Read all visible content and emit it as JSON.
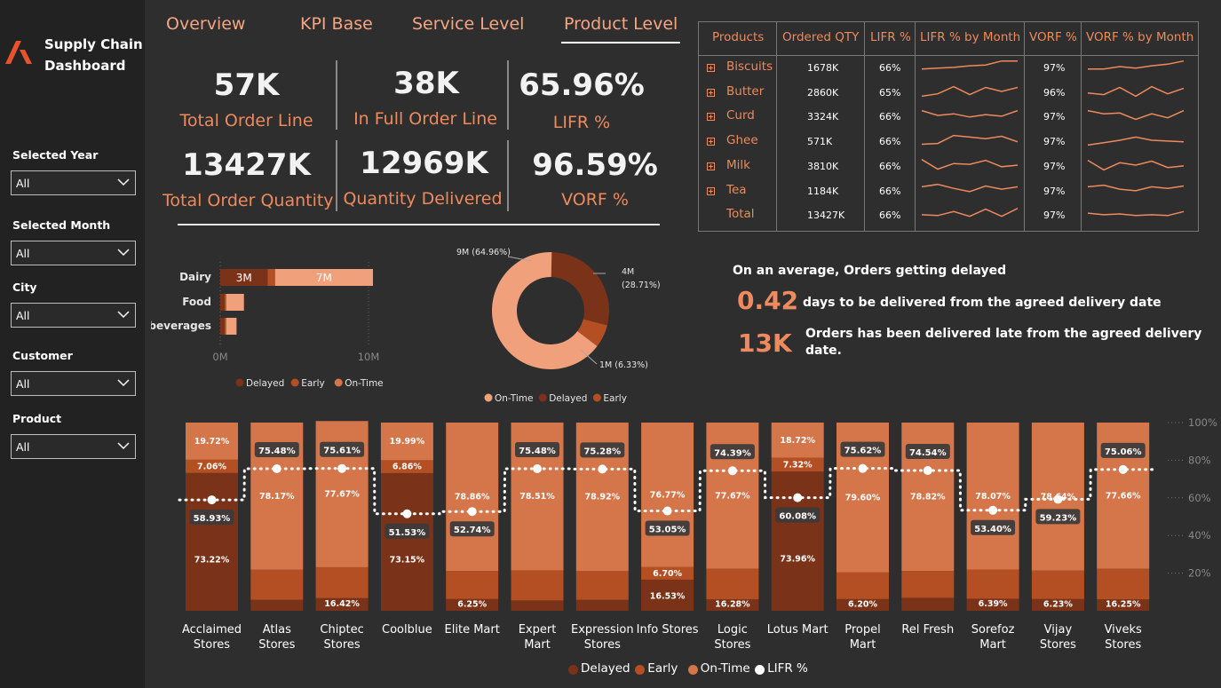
{
  "app": {
    "title_line1": "Supply Chain",
    "title_line2": "Dashboard"
  },
  "tabs": [
    {
      "label": "Overview"
    },
    {
      "label": "KPI Base"
    },
    {
      "label": "Service Level"
    },
    {
      "label": "Product Level"
    }
  ],
  "filters": [
    {
      "label": "Selected Year",
      "value": "All"
    },
    {
      "label": "Selected Month",
      "value": "All"
    },
    {
      "label": "City",
      "value": "All"
    },
    {
      "label": "Customer",
      "value": "All"
    },
    {
      "label": "Product",
      "value": "All"
    }
  ],
  "kpis": [
    {
      "value": "57K",
      "label": "Total Order Line"
    },
    {
      "value": "38K",
      "label": "In Full Order Line"
    },
    {
      "value": "65.96%",
      "label": "LIFR %"
    },
    {
      "value": "13427K",
      "label": "Total Order Quantity"
    },
    {
      "value": "12969K",
      "label": "Quantity Delivered"
    },
    {
      "value": "96.59%",
      "label": "VORF %"
    }
  ],
  "product_table": {
    "headers": [
      "Products",
      "Ordered QTY",
      "LIFR %",
      "LIFR % by Month",
      "VORF %",
      "VORF % by Month"
    ],
    "rows": [
      {
        "name": "Biscuits",
        "qty": "1678K",
        "lifr": "66%",
        "vorf": "97%",
        "lifr_trend": [
          0.35,
          0.4,
          0.45,
          0.55,
          0.6,
          0.85,
          0.85
        ],
        "vorf_trend": [
          0.35,
          0.35,
          0.5,
          0.4,
          0.55,
          0.65,
          0.85
        ]
      },
      {
        "name": "Butter",
        "qty": "2860K",
        "lifr": "65%",
        "vorf": "96%",
        "lifr_trend": [
          0.2,
          0.35,
          0.8,
          0.3,
          0.75,
          0.5,
          0.75
        ],
        "vorf_trend": [
          0.4,
          0.3,
          0.75,
          0.2,
          0.8,
          0.35,
          0.7
        ]
      },
      {
        "name": "Curd",
        "qty": "3324K",
        "lifr": "66%",
        "vorf": "97%",
        "lifr_trend": [
          0.8,
          0.5,
          0.6,
          0.4,
          0.55,
          0.45,
          0.8
        ],
        "vorf_trend": [
          0.8,
          0.6,
          0.65,
          0.25,
          0.6,
          0.35,
          0.8
        ]
      },
      {
        "name": "Ghee",
        "qty": "571K",
        "lifr": "66%",
        "vorf": "97%",
        "lifr_trend": [
          0.25,
          0.3,
          0.8,
          0.7,
          0.6,
          0.75,
          0.4
        ],
        "vorf_trend": [
          0.2,
          0.35,
          0.5,
          0.7,
          0.5,
          0.45,
          0.4
        ]
      },
      {
        "name": "Milk",
        "qty": "3810K",
        "lifr": "66%",
        "vorf": "97%",
        "lifr_trend": [
          0.85,
          0.25,
          0.6,
          0.55,
          0.8,
          0.4,
          0.5
        ],
        "vorf_trend": [
          0.8,
          0.2,
          0.65,
          0.5,
          0.75,
          0.35,
          0.45
        ]
      },
      {
        "name": "Tea",
        "qty": "1184K",
        "lifr": "66%",
        "vorf": "97%",
        "lifr_trend": [
          0.7,
          0.85,
          0.6,
          0.4,
          0.75,
          0.55,
          0.7
        ],
        "vorf_trend": [
          0.7,
          0.8,
          0.55,
          0.45,
          0.7,
          0.6,
          0.75
        ]
      },
      {
        "name": "Total",
        "qty": "13427K",
        "lifr": "66%",
        "vorf": "97%",
        "lifr_trend": [
          0.45,
          0.4,
          0.65,
          0.35,
          0.8,
          0.35,
          0.85
        ],
        "vorf_trend": [
          0.55,
          0.45,
          0.5,
          0.4,
          0.45,
          0.4,
          0.65
        ]
      }
    ]
  },
  "category_chart": {
    "categories": [
      "Dairy",
      "Food",
      "beverages"
    ],
    "axis_labels": [
      "0M",
      "10M"
    ],
    "legend": [
      "Delayed",
      "Early",
      "On-Time"
    ]
  },
  "donut_chart": {
    "labels": [
      "9M (64.96%)",
      "4M",
      "(28.71%)",
      "1M (6.33%)"
    ],
    "legend": [
      "On-Time",
      "Delayed",
      "Early"
    ]
  },
  "delay": {
    "heading": "On an average, Orders getting delayed",
    "days_value": "0.42",
    "days_desc": "days to be delivered from the agreed delivery date",
    "late_value": "13K",
    "late_desc_line1": "Orders has been delivered late from the agreed delivery",
    "late_desc_line2": "date."
  },
  "colors": {
    "delayed": "#7a3319",
    "early": "#b34f22",
    "ontime": "#d4754a",
    "ontime_light": "#f0a07a",
    "accent": "#ee8a5d",
    "lifr": "#ffffff"
  },
  "chart_data": [
    {
      "type": "bar",
      "title": "",
      "orientation": "horizontal",
      "stacked": true,
      "categories": [
        "Dairy",
        "Food",
        "beverages"
      ],
      "series": [
        {
          "name": "Delayed",
          "values": [
            3.2,
            0.3,
            0.3
          ]
        },
        {
          "name": "Early",
          "values": [
            0.5,
            0.1,
            0.1
          ]
        },
        {
          "name": "On-Time",
          "values": [
            6.6,
            1.2,
            0.7
          ]
        }
      ],
      "data_labels": [
        "3M",
        "7M"
      ],
      "xlim": [
        0,
        10
      ],
      "xunit": "M",
      "legend_position": "bottom"
    },
    {
      "type": "pie",
      "title": "",
      "donut": true,
      "labels": [
        "On-Time",
        "Delayed",
        "Early"
      ],
      "values": [
        64.96,
        28.71,
        6.33
      ],
      "legend_position": "bottom"
    },
    {
      "type": "bar",
      "title": "",
      "stacked": true,
      "percent": true,
      "categories": [
        "Acclaimed Stores",
        "Atlas Stores",
        "Chiptec Stores",
        "Coolblue",
        "Elite Mart",
        "Expert Mart",
        "Expression Stores",
        "Info Stores",
        "Logic Stores",
        "Lotus Mart",
        "Propel Mart",
        "Rel Fresh",
        "Sorefoz Mart",
        "Vijay Stores",
        "Viveks Stores"
      ],
      "series": [
        {
          "name": "Delayed",
          "values": [
            73.22,
            5.83,
            6.72,
            73.15,
            6.25,
            5.49,
            5.8,
            16.53,
            6.05,
            73.96,
            6.2,
            6.88,
            6.39,
            6.23,
            6.09
          ]
        },
        {
          "name": "Early",
          "values": [
            7.06,
            16.0,
            16.42,
            6.86,
            14.89,
            16.0,
            15.28,
            6.7,
            16.28,
            7.32,
            14.2,
            14.3,
            15.54,
            15.13,
            16.25
          ]
        },
        {
          "name": "On-Time",
          "values": [
            19.72,
            78.17,
            77.67,
            19.99,
            78.86,
            78.51,
            78.92,
            76.77,
            77.67,
            18.72,
            79.6,
            78.82,
            78.07,
            78.64,
            77.66
          ]
        }
      ],
      "bar_labels_top": [
        "19.72%",
        "",
        "",
        "19.99%",
        "",
        "",
        "",
        "",
        "",
        "18.72%",
        "",
        "",
        "",
        "",
        ""
      ],
      "bar_labels_mid": [
        "7.06%",
        "78.17%",
        "77.67%",
        "6.86%",
        "78.86%",
        "78.51%",
        "78.92%",
        "76.77%",
        "77.67%",
        "7.32%",
        "79.60%",
        "78.82%",
        "78.07%",
        "78.64%",
        "77.66%"
      ],
      "bar_labels_low": [
        "73.22%",
        "",
        "16.42%",
        "73.15%",
        "6.25%",
        "",
        "",
        "6.70%",
        "16.28%",
        "73.96%",
        "6.20%",
        "",
        "6.39%",
        "6.23%",
        "16.25%"
      ],
      "bar_labels_extra": [
        "",
        "",
        "",
        "",
        "",
        "",
        "",
        "16.53%",
        "",
        "",
        "",
        "",
        "",
        "",
        ""
      ],
      "line_series": {
        "name": "LIFR %",
        "values": [
          58.93,
          75.48,
          75.61,
          51.53,
          52.74,
          75.48,
          75.28,
          53.05,
          74.39,
          60.08,
          75.62,
          74.54,
          53.4,
          59.23,
          75.06
        ]
      },
      "line_labels": [
        "58.93%",
        "75.48%",
        "75.61%",
        "51.53%",
        "52.74%",
        "75.48%",
        "75.28%",
        "53.05%",
        "74.39%",
        "60.08%",
        "75.62%",
        "74.54%",
        "53.40%",
        "59.23%",
        "75.06%"
      ],
      "y_ticks": [
        "100%",
        "80%",
        "60%",
        "40%",
        "20%"
      ],
      "ylim": [
        0,
        100
      ],
      "legend": [
        "Delayed",
        "Early",
        "On-Time",
        "LIFR %"
      ],
      "legend_position": "bottom"
    }
  ]
}
